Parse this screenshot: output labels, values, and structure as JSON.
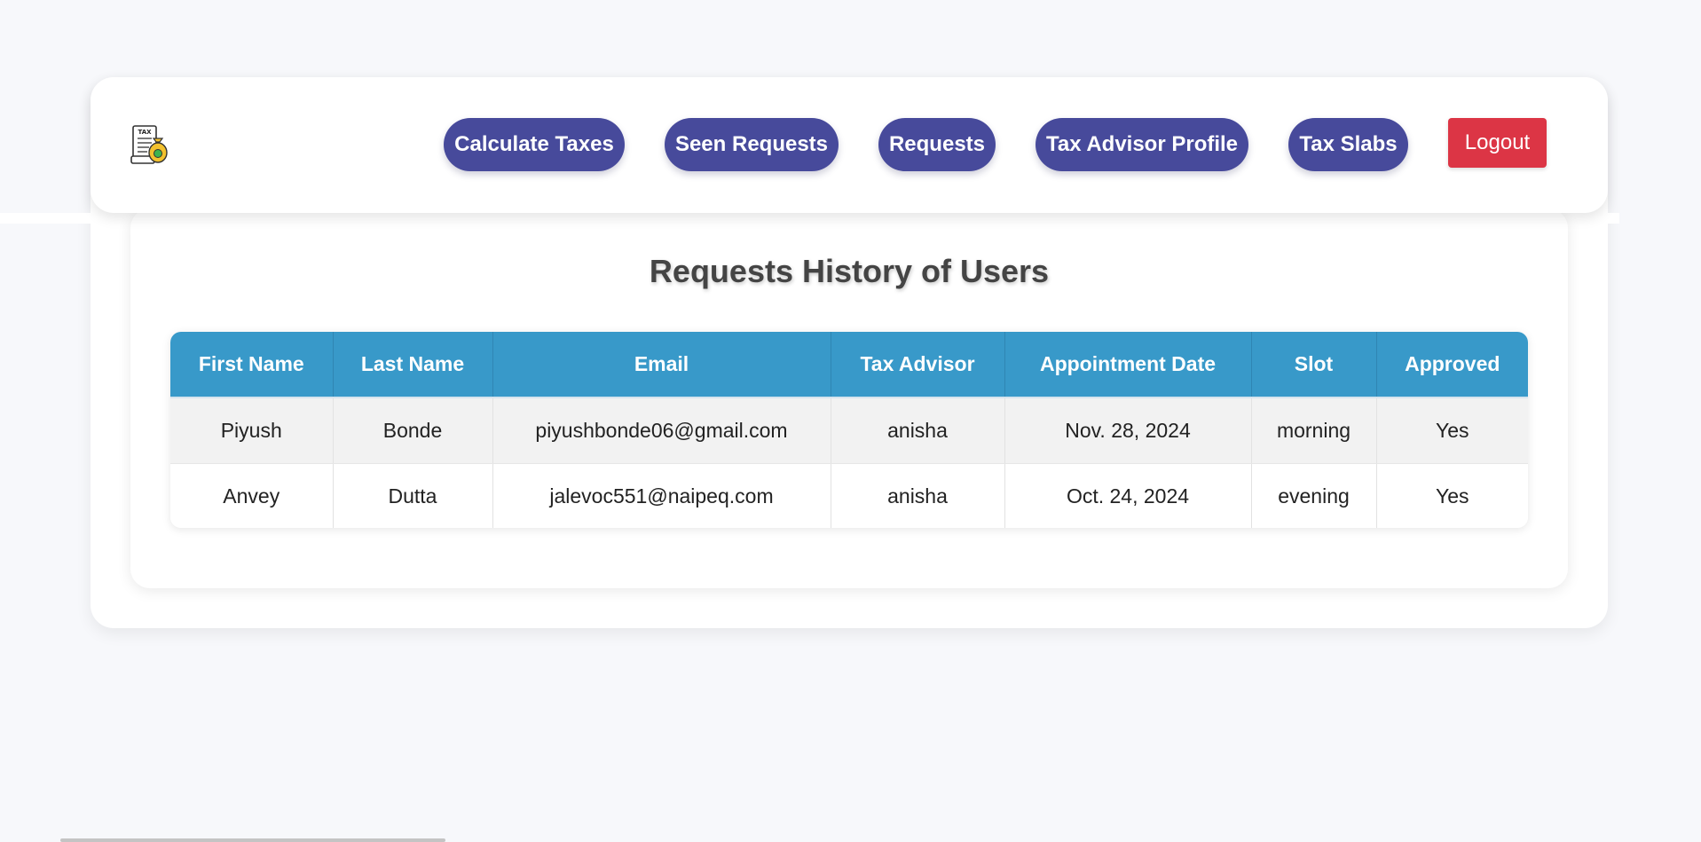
{
  "nav": {
    "logo_text": "TAX",
    "buttons": [
      "Calculate Taxes",
      "Seen Requests",
      "Requests",
      "Tax Advisor Profile",
      "Tax Slabs"
    ],
    "logout_label": "Logout"
  },
  "main": {
    "title": "Requests History of Users",
    "table": {
      "headers": [
        "First Name",
        "Last Name",
        "Email",
        "Tax Advisor",
        "Appointment Date",
        "Slot",
        "Approved"
      ],
      "rows": [
        [
          "Piyush",
          "Bonde",
          "piyushbonde06@gmail.com",
          "anisha",
          "Nov. 28, 2024",
          "morning",
          "Yes"
        ],
        [
          "Anvey",
          "Dutta",
          "jalevoc551@naipeq.com",
          "anisha",
          "Oct. 24, 2024",
          "evening",
          "Yes"
        ]
      ]
    }
  },
  "colors": {
    "nav_button": "#474a9b",
    "logout": "#dc3545",
    "table_header": "#3899c9",
    "page_background": "#f7f8fb"
  }
}
